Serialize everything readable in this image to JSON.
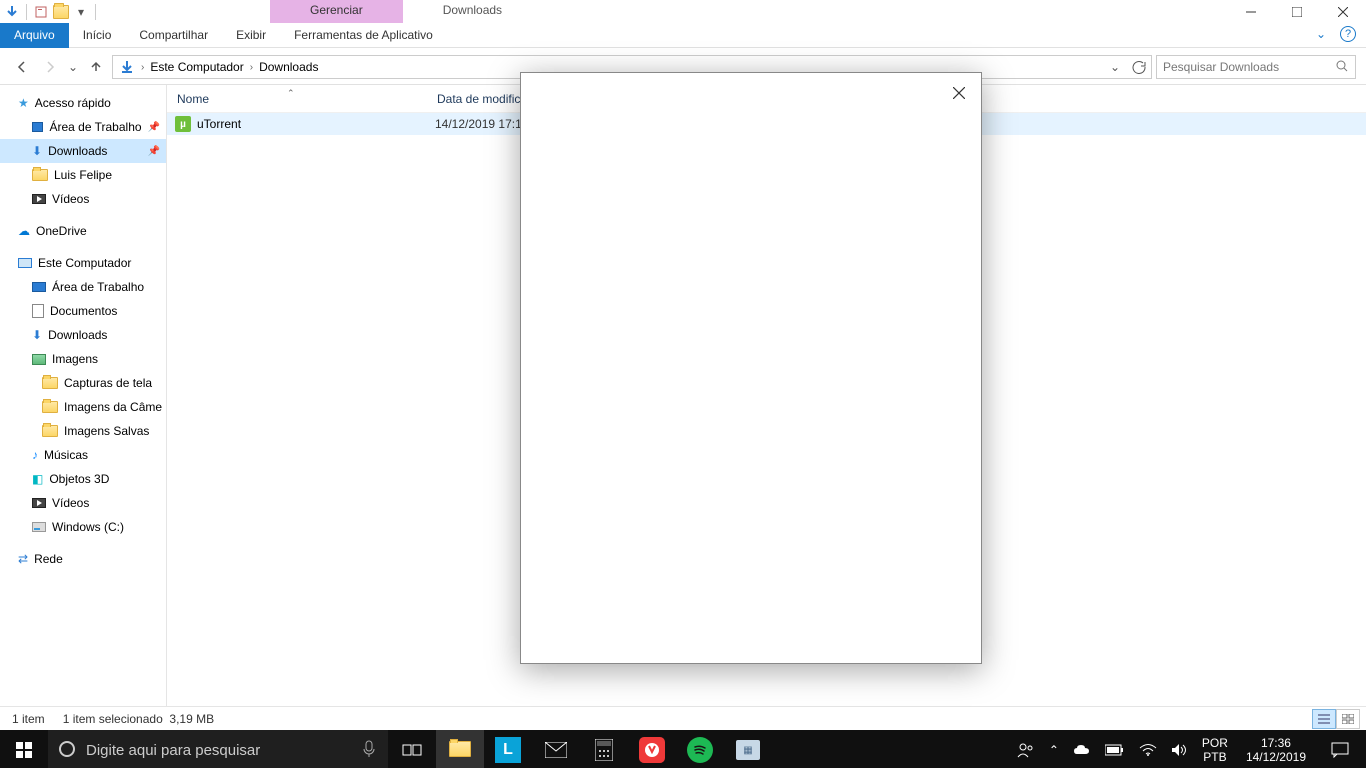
{
  "title_tabs": {
    "manage": "Gerenciar",
    "titlewin": "Downloads"
  },
  "ribbon": {
    "file": "Arquivo",
    "home": "Início",
    "share": "Compartilhar",
    "view": "Exibir",
    "apptools": "Ferramentas de Aplicativo"
  },
  "breadcrumb": {
    "root": "Este Computador",
    "current": "Downloads"
  },
  "search": {
    "placeholder": "Pesquisar Downloads"
  },
  "columns": {
    "name": "Nome",
    "date": "Data de modific"
  },
  "file": {
    "name": "uTorrent",
    "date": "14/12/2019 17:1"
  },
  "tree": {
    "quick": "Acesso rápido",
    "desktop": "Área de Trabalho",
    "downloads": "Downloads",
    "luis": "Luis Felipe",
    "videos": "Vídeos",
    "onedrive": "OneDrive",
    "thispc": "Este Computador",
    "desktop2": "Área de Trabalho",
    "documents": "Documentos",
    "downloads2": "Downloads",
    "images": "Imagens",
    "screenshots": "Capturas de tela",
    "camera": "Imagens da Câme",
    "saved": "Imagens Salvas",
    "music": "Músicas",
    "objects3d": "Objetos 3D",
    "videos2": "Vídeos",
    "cdrive": "Windows (C:)",
    "network": "Rede"
  },
  "status": {
    "count": "1 item",
    "selected": "1 item selecionado",
    "size": "3,19 MB"
  },
  "taskbar": {
    "search_placeholder": "Digite aqui para pesquisar",
    "lang1": "POR",
    "lang2": "PTB",
    "time": "17:36",
    "date": "14/12/2019"
  }
}
